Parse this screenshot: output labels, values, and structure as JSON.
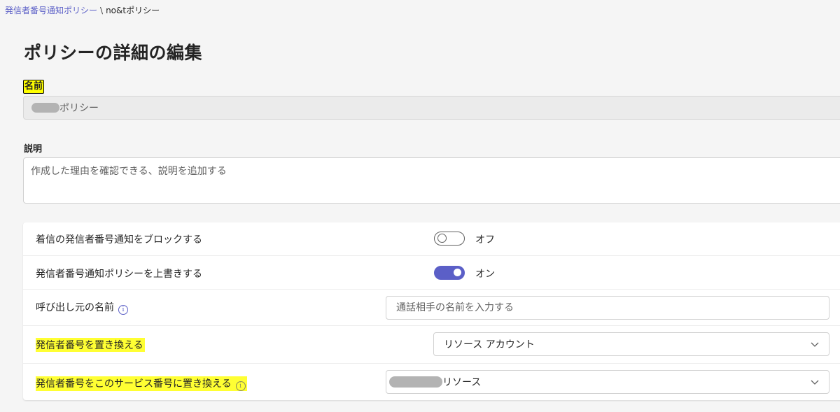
{
  "breadcrumb": {
    "parent": "発信者番号通知ポリシー",
    "separator": "\\",
    "current": "no&tポリシー"
  },
  "page_title": "ポリシーの詳細の編集",
  "name": {
    "label": "名前",
    "value": "ポリシー"
  },
  "description": {
    "label": "説明",
    "placeholder": "作成した理由を確認できる、説明を追加する"
  },
  "settings": {
    "block_incoming": {
      "label": "着信の発信者番号通知をブロックする",
      "state": "オフ"
    },
    "override_policy": {
      "label": "発信者番号通知ポリシーを上書きする",
      "state": "オン"
    },
    "caller_name": {
      "label": "呼び出し元の名前",
      "placeholder": "通話相手の名前を入力する"
    },
    "replace_caller_id": {
      "label": "発信者番号を置き換える",
      "value": "リソース アカウント"
    },
    "replace_with_service": {
      "label": "発信者番号をこのサービス番号に置き換える",
      "value": "リソース"
    }
  },
  "colors": {
    "accent": "#5b5fc7",
    "highlight": "#ffff33",
    "background": "#f5f5f5"
  }
}
